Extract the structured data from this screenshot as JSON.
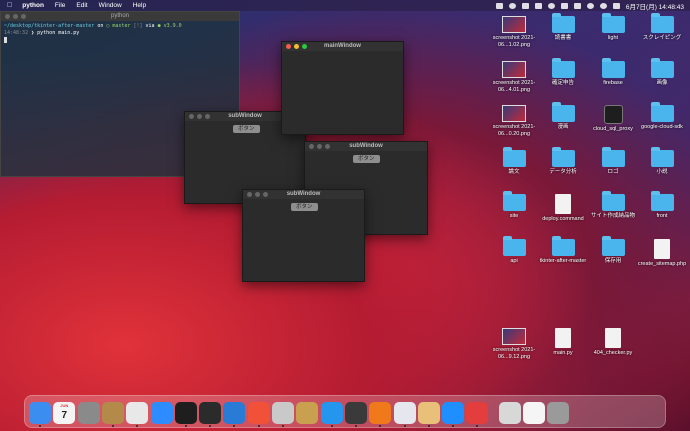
{
  "menubar": {
    "app": "python",
    "items": [
      "File",
      "Edit",
      "Window",
      "Help"
    ],
    "datetime": "6月7日(月)  14:48:43"
  },
  "terminal": {
    "title": "python",
    "prompt_path": "~/desktop/tkinter-after-master",
    "prompt_on": "on",
    "prompt_branch": "master",
    "prompt_status": "[!]",
    "prompt_via": "via",
    "prompt_version": "v3.9.0",
    "time": "14:48:32",
    "command": "python main.py"
  },
  "windows": {
    "main": {
      "title": "mainWindow"
    },
    "sub1": {
      "title": "subWindow",
      "button": "ボタン"
    },
    "sub2": {
      "title": "subWindow",
      "button": "ボタン"
    },
    "sub3": {
      "title": "subWindow",
      "button": "ボタン"
    }
  },
  "desktop_icons": [
    {
      "label": "screenshot 2021-06...1.02.png",
      "type": "shot"
    },
    {
      "label": "読書書",
      "type": "folder"
    },
    {
      "label": "light",
      "type": "folder"
    },
    {
      "label": "スクレイピング",
      "type": "folder"
    },
    {
      "label": "screenshot 2021-06...4.01.png",
      "type": "shot"
    },
    {
      "label": "確定申告",
      "type": "folder"
    },
    {
      "label": "firebase",
      "type": "folder"
    },
    {
      "label": "画像",
      "type": "folder"
    },
    {
      "label": "screenshot 2021-06...0.20.png",
      "type": "shot"
    },
    {
      "label": "漫画",
      "type": "folder"
    },
    {
      "label": "cloud_sql_proxy",
      "type": "termapp"
    },
    {
      "label": "google-cloud-sdk",
      "type": "folder"
    },
    {
      "label": "論文",
      "type": "folder"
    },
    {
      "label": "データ分析",
      "type": "folder"
    },
    {
      "label": "ロゴ",
      "type": "folder"
    },
    {
      "label": "小説",
      "type": "folder"
    },
    {
      "label": "site",
      "type": "folder"
    },
    {
      "label": "deploy.command",
      "type": "doc"
    },
    {
      "label": "サイト作成納品物",
      "type": "folder"
    },
    {
      "label": "front",
      "type": "folder"
    },
    {
      "label": "api",
      "type": "folder"
    },
    {
      "label": "tkinter-after-master",
      "type": "folder"
    },
    {
      "label": "保存用",
      "type": "folder"
    },
    {
      "label": "create_sitemap.php",
      "type": "doc"
    },
    {
      "label": "screenshot 2021-06...9.12.png",
      "type": "shot"
    },
    {
      "label": "main.py",
      "type": "doc"
    },
    {
      "label": "404_checker.py",
      "type": "doc"
    }
  ],
  "dock_apps": [
    {
      "name": "Finder",
      "color": "#3b8ef0"
    },
    {
      "name": "Calendar",
      "color": "#f4f4f4"
    },
    {
      "name": "System Preferences",
      "color": "#8a8a8a"
    },
    {
      "name": "Notes App",
      "color": "#b48a4a"
    },
    {
      "name": "Chrome",
      "color": "#e8e8e8"
    },
    {
      "name": "Zoom",
      "color": "#2d8cff"
    },
    {
      "name": "Terminal",
      "color": "#1e1e1e"
    },
    {
      "name": "Terminal 2",
      "color": "#2b2b2b"
    },
    {
      "name": "VS Code",
      "color": "#2a7bd6"
    },
    {
      "name": "Swift Playgrounds",
      "color": "#f05138"
    },
    {
      "name": "Sequel Pro",
      "color": "#c9c9c9"
    },
    {
      "name": "Archive Utility",
      "color": "#c8a050"
    },
    {
      "name": "Docker",
      "color": "#2496ed"
    },
    {
      "name": "Proxyman",
      "color": "#3a3a3a"
    },
    {
      "name": "Sourcetree",
      "color": "#f07a1b"
    },
    {
      "name": "Vivaldi",
      "color": "#e6e6ef"
    },
    {
      "name": "Preview",
      "color": "#e8c07a"
    },
    {
      "name": "Loop",
      "color": "#1f8fff"
    },
    {
      "name": "Clock",
      "color": "#e43d3d"
    },
    {
      "name": "Downloads",
      "color": "#d8d8d8"
    },
    {
      "name": "Document",
      "color": "#f5f5f5"
    },
    {
      "name": "Trash",
      "color": "#9a9a9a"
    }
  ],
  "calendar_day": "7",
  "calendar_month": "JUN"
}
